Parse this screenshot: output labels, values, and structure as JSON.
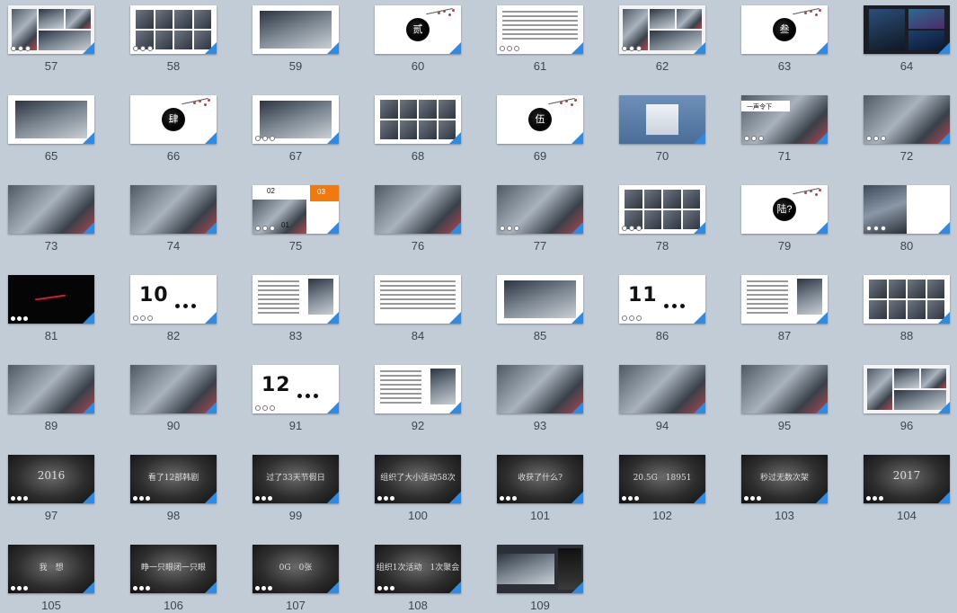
{
  "slides": [
    {
      "number": "57",
      "theme": "collage",
      "dots": "ring"
    },
    {
      "number": "58",
      "theme": "grid",
      "dots": "ring"
    },
    {
      "number": "59",
      "theme": "white-photo",
      "dots": "none"
    },
    {
      "number": "60",
      "theme": "brush",
      "char": "贰",
      "dots": "none"
    },
    {
      "number": "61",
      "theme": "text",
      "dots": "ring"
    },
    {
      "number": "62",
      "theme": "collage",
      "dots": "ring"
    },
    {
      "number": "63",
      "theme": "brush",
      "char": "叁",
      "dots": "none"
    },
    {
      "number": "64",
      "theme": "dark-photo",
      "dots": "none"
    },
    {
      "number": "65",
      "theme": "white-photo",
      "dots": "none"
    },
    {
      "number": "66",
      "theme": "brush",
      "char": "肆",
      "dots": "none"
    },
    {
      "number": "67",
      "theme": "white-photo",
      "dots": "ring"
    },
    {
      "number": "68",
      "theme": "grid",
      "dots": "none"
    },
    {
      "number": "69",
      "theme": "brush",
      "char": "伍",
      "dots": "none"
    },
    {
      "number": "70",
      "theme": "blue",
      "dots": "none"
    },
    {
      "number": "71",
      "theme": "photo-title",
      "title": "一声令下",
      "dots": "ring"
    },
    {
      "number": "72",
      "theme": "photo",
      "dots": "ring"
    },
    {
      "number": "73",
      "theme": "photo",
      "dots": "none"
    },
    {
      "number": "74",
      "theme": "photo",
      "dots": "none"
    },
    {
      "number": "75",
      "theme": "numbered",
      "labels": [
        "02",
        "03",
        "01"
      ],
      "dots": "ring"
    },
    {
      "number": "76",
      "theme": "photo",
      "dots": "none"
    },
    {
      "number": "77",
      "theme": "photo",
      "dots": "ring"
    },
    {
      "number": "78",
      "theme": "grid",
      "dots": "ring"
    },
    {
      "number": "79",
      "theme": "brush",
      "char": "陆?",
      "dots": "none"
    },
    {
      "number": "80",
      "theme": "poster",
      "dots": "ring"
    },
    {
      "number": "81",
      "theme": "black",
      "dots": "fill"
    },
    {
      "number": "82",
      "theme": "big-number",
      "big": "10",
      "dots": "ring"
    },
    {
      "number": "83",
      "theme": "text-poster",
      "dots": "none"
    },
    {
      "number": "84",
      "theme": "text",
      "dots": "none"
    },
    {
      "number": "85",
      "theme": "white-photo",
      "dots": "none"
    },
    {
      "number": "86",
      "theme": "big-number",
      "big": "11",
      "dots": "ring"
    },
    {
      "number": "87",
      "theme": "text-poster",
      "dots": "none"
    },
    {
      "number": "88",
      "theme": "grid",
      "dots": "none"
    },
    {
      "number": "89",
      "theme": "photo",
      "dots": "none"
    },
    {
      "number": "90",
      "theme": "photo",
      "dots": "none"
    },
    {
      "number": "91",
      "theme": "big-number",
      "big": "12",
      "dots": "ring"
    },
    {
      "number": "92",
      "theme": "text-poster",
      "dots": "none"
    },
    {
      "number": "93",
      "theme": "photo",
      "dots": "none"
    },
    {
      "number": "94",
      "theme": "photo",
      "dots": "none"
    },
    {
      "number": "95",
      "theme": "photo",
      "dots": "none"
    },
    {
      "number": "96",
      "theme": "collage",
      "dots": "none"
    },
    {
      "number": "97",
      "theme": "dark",
      "text": "2016",
      "dots": "fill"
    },
    {
      "number": "98",
      "theme": "dark",
      "text": "看了12部韩剧",
      "dots": "fill"
    },
    {
      "number": "99",
      "theme": "dark",
      "text": "过了33天节假日",
      "dots": "fill"
    },
    {
      "number": "100",
      "theme": "dark",
      "text": "组织了大小活动58次",
      "dots": "fill"
    },
    {
      "number": "101",
      "theme": "dark",
      "text": "收获了什么?",
      "dots": "fill"
    },
    {
      "number": "102",
      "theme": "dark",
      "text": "20.5G　18951",
      "dots": "fill"
    },
    {
      "number": "103",
      "theme": "dark",
      "text": "秒过无数次架",
      "dots": "fill"
    },
    {
      "number": "104",
      "theme": "dark",
      "text": "2017",
      "dots": "fill"
    },
    {
      "number": "105",
      "theme": "dark",
      "text": "我　想",
      "dots": "fill"
    },
    {
      "number": "106",
      "theme": "dark",
      "text": "睁一只眼闭一只眼",
      "dots": "fill"
    },
    {
      "number": "107",
      "theme": "dark",
      "text": "0G　0张",
      "dots": "fill"
    },
    {
      "number": "108",
      "theme": "dark",
      "text": "组织1次活动　1次聚会",
      "dots": "fill"
    },
    {
      "number": "109",
      "theme": "end-photo",
      "dots": "none"
    }
  ],
  "colors": {
    "background": "#c2ccd6",
    "corner": "#2f8ae0",
    "label": "#3c4650",
    "accent": "#f07a10"
  }
}
